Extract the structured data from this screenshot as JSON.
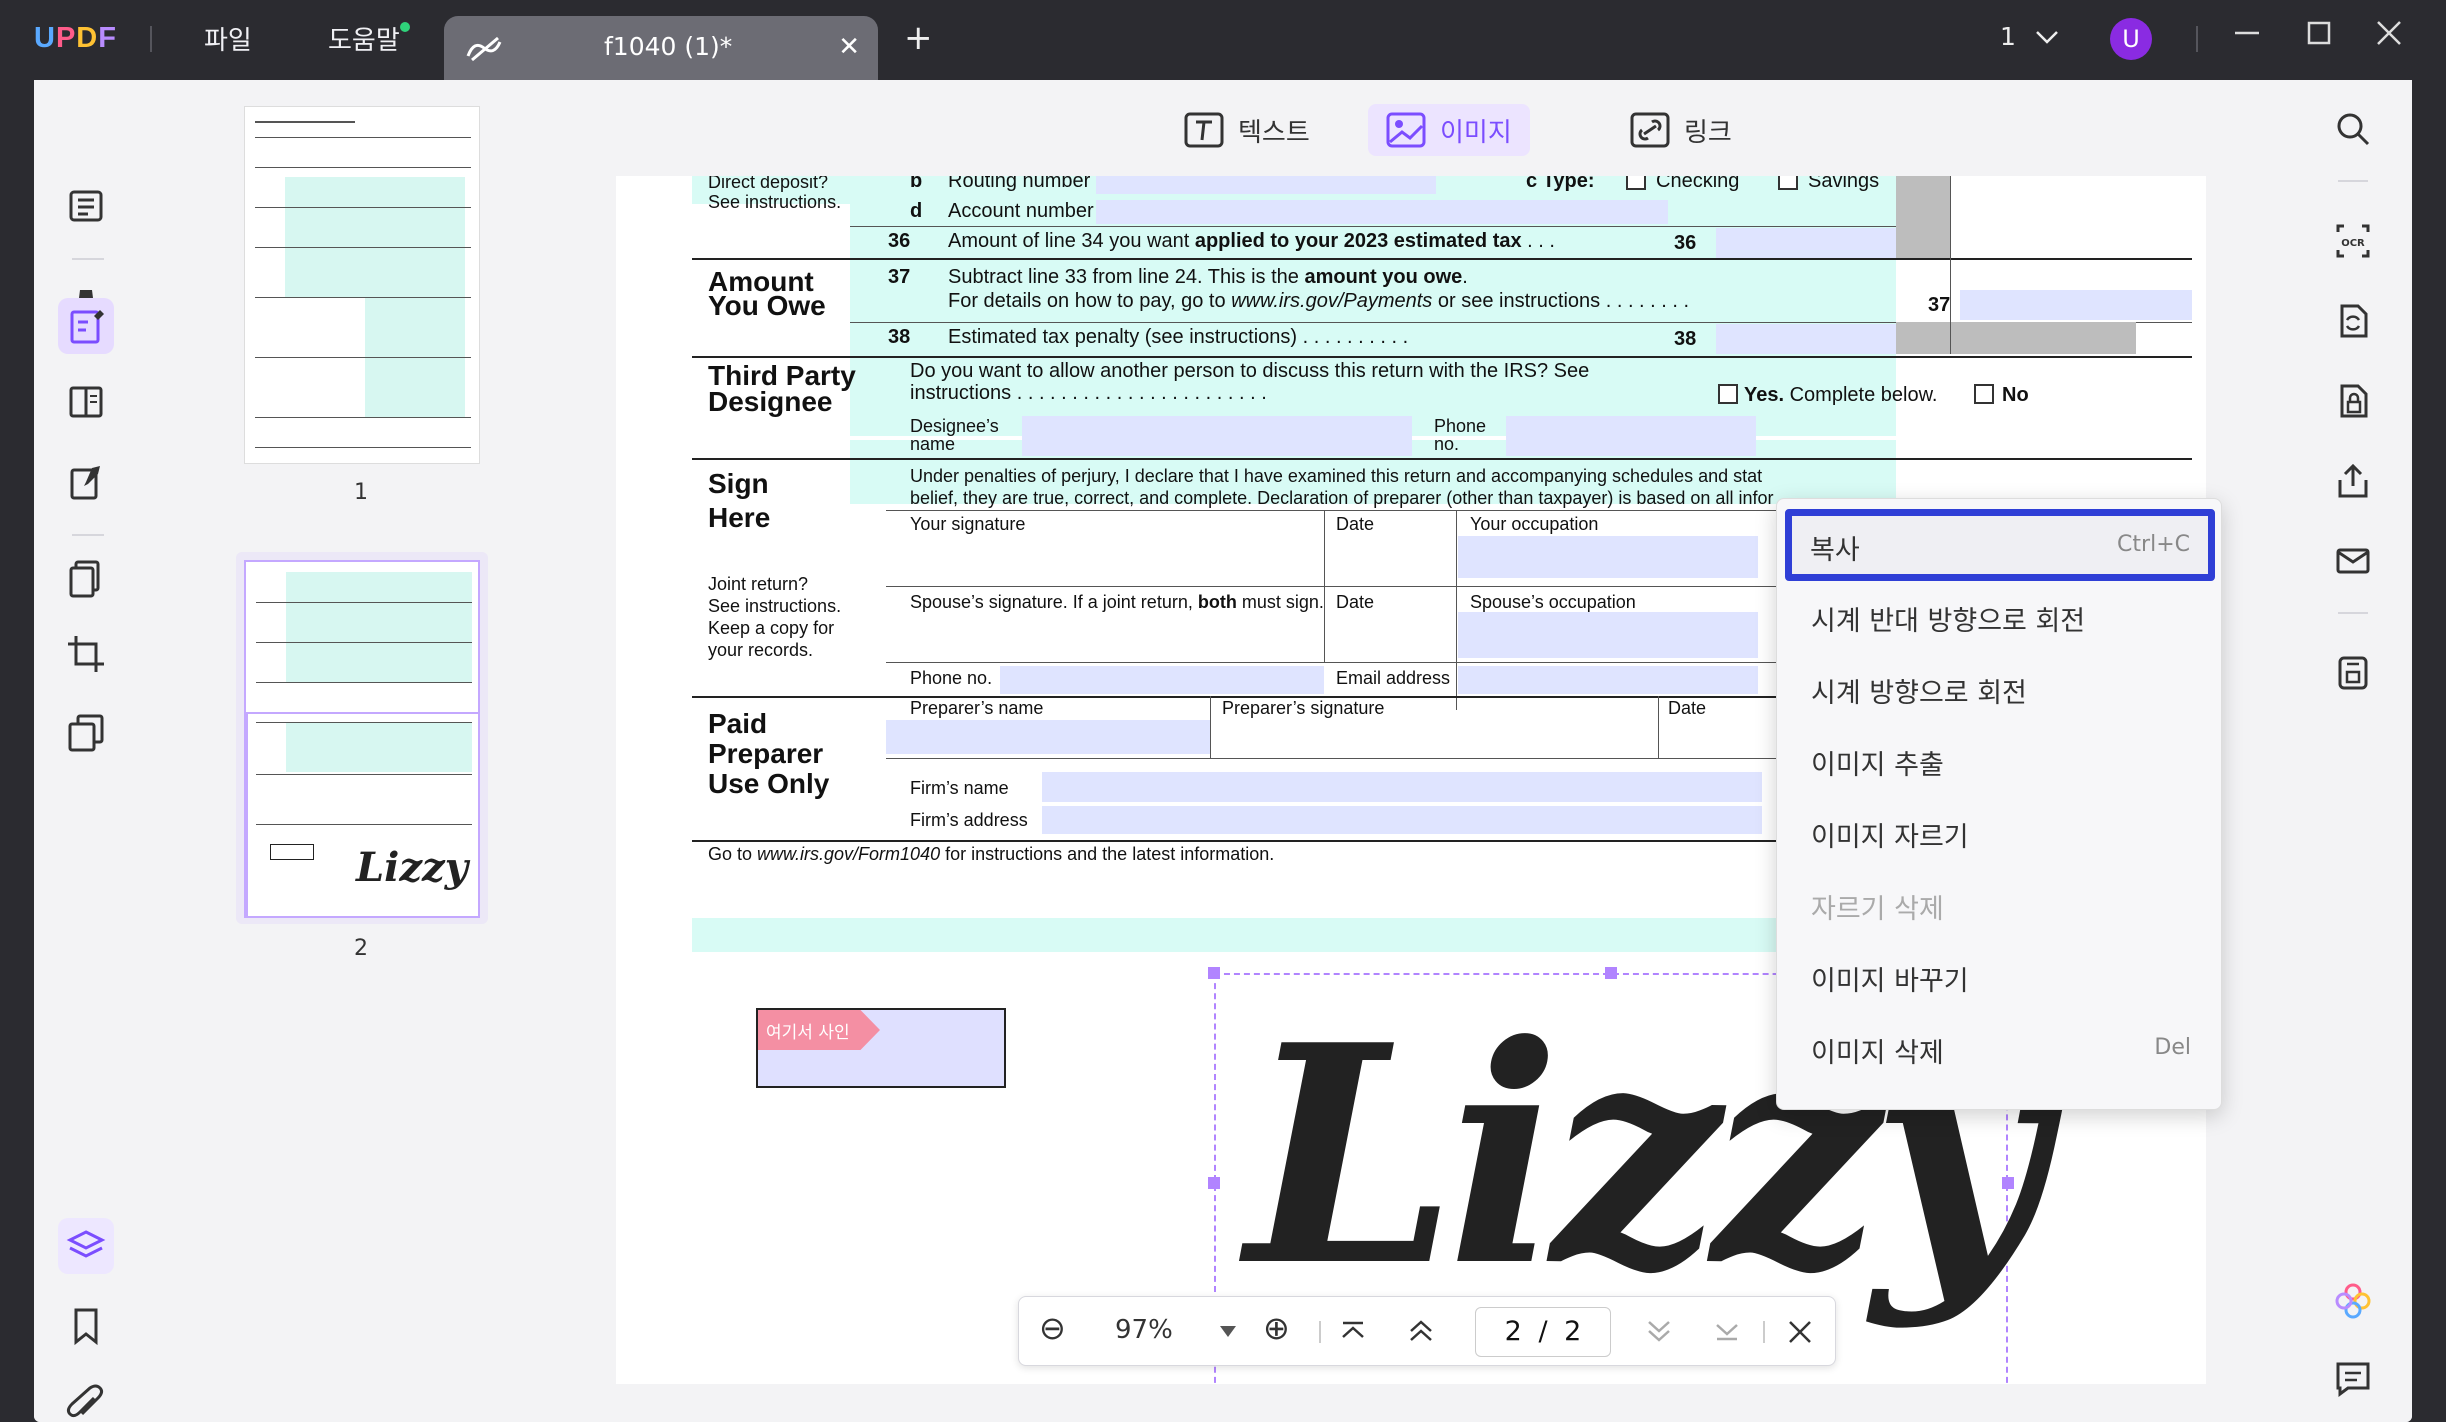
{
  "titlebar": {
    "logo": "UPDF",
    "menu_file": "파일",
    "menu_help": "도움말",
    "tab_title": "f1040 (1)*",
    "tab_close": "✕",
    "new_tab": "+",
    "page_selector": "1",
    "avatar_initial": "U"
  },
  "modes": {
    "text": "텍스트",
    "image": "이미지",
    "link": "링크"
  },
  "thumbnails": [
    {
      "label": "1"
    },
    {
      "label": "2"
    }
  ],
  "document": {
    "direct_deposit": "Direct deposit?",
    "see_instructions": "See instructions.",
    "b": "b",
    "routing": "Routing number",
    "c_type": "c Type:",
    "checking": "Checking",
    "savings": "Savings",
    "d": "d",
    "account": "Account number",
    "l36_num": "36",
    "l36_text_a": "Amount of line 34 you want ",
    "l36_text_b": "applied to your 2023 estimated tax",
    "l36_box": "36",
    "amount_you_owe_1": "Amount",
    "amount_you_owe_2": "You Owe",
    "l37_num": "37",
    "l37_text_a": "Subtract line 33 from line 24. This is the ",
    "l37_text_b": "amount you owe",
    "l37_text_c": ".",
    "l37_text2_a": "For details on how to pay, go to ",
    "l37_text2_b": "www.irs.gov/Payments",
    "l37_text2_c": " or see instructions",
    "l37_box": "37",
    "l38_num": "38",
    "l38_text": "Estimated tax penalty (see instructions)",
    "l38_box": "38",
    "third_party_1": "Third Party",
    "third_party_2": "Designee",
    "tp_text": "Do you want to allow another person to discuss this return with the IRS? See",
    "tp_text2": "instructions",
    "yes": "Yes.",
    "complete_below": " Complete below.",
    "no": "No",
    "designee_name_1": "Designee’s",
    "designee_name_2": "name",
    "phone_1": "Phone",
    "phone_2": "no.",
    "sign_1": "Sign",
    "sign_2": "Here",
    "perjury_1": "Under penalties of perjury, I declare that I have examined this return and accompanying schedules and stat",
    "perjury_2": "belief, they are true, correct, and complete. Declaration of preparer (other than taxpayer) is based on all infor",
    "your_signature": "Your signature",
    "date": "Date",
    "your_occupation": "Your occupation",
    "joint_1": "Joint return?",
    "joint_2": "See instructions.",
    "joint_3": "Keep a copy for",
    "joint_4": "your records.",
    "spouse_sig_a": "Spouse’s signature. If a joint return, ",
    "spouse_sig_b": "both",
    "spouse_sig_c": " must sign.",
    "date2": "Date",
    "spouse_occ": "Spouse’s occupation",
    "phone_no": "Phone no.",
    "email": "Email address",
    "paid_1": "Paid",
    "paid_2": "Preparer",
    "paid_3": "Use Only",
    "prep_name": "Preparer’s name",
    "prep_sig": "Preparer’s signature",
    "date3": "Date",
    "firm_name": "Firm’s name",
    "firm_address": "Firm’s address",
    "footer_a": "Go to ",
    "footer_b": "www.irs.gov/Form1040",
    "footer_c": " for instructions and the latest information.",
    "sign_here_tag": "여기서 사인",
    "signature": "Lizzy"
  },
  "context_menu": [
    {
      "label": "복사",
      "shortcut": "Ctrl+C",
      "state": "highlighted"
    },
    {
      "label": "시계 반대 방향으로 회전",
      "shortcut": "",
      "state": "normal"
    },
    {
      "label": "시계 방향으로 회전",
      "shortcut": "",
      "state": "normal"
    },
    {
      "label": "이미지 추출",
      "shortcut": "",
      "state": "normal"
    },
    {
      "label": "이미지 자르기",
      "shortcut": "",
      "state": "normal"
    },
    {
      "label": "자르기 삭제",
      "shortcut": "",
      "state": "disabled"
    },
    {
      "label": "이미지 바꾸기",
      "shortcut": "",
      "state": "normal"
    },
    {
      "label": "이미지 삭제",
      "shortcut": "Del",
      "state": "normal"
    }
  ],
  "zoombar": {
    "zoom_out": "⊖",
    "zoom_value": "97%",
    "zoom_in": "⊕",
    "current_page": "2",
    "separator": "/",
    "total_pages": "2"
  },
  "colors": {
    "accent": "#8b5cf6",
    "highlight_border": "#2f3fd6",
    "form_cyan": "#d8fbf5",
    "field_blue": "#dfe4ff"
  }
}
